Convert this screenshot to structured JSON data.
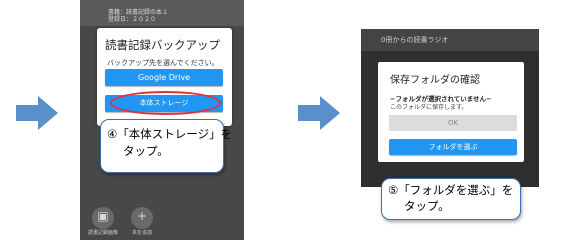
{
  "colors": {
    "arrow": "#5b8fc9",
    "button_blue": "#2196f3",
    "highlight_red": "#e0303a",
    "callout_border": "#3a6fb0"
  },
  "screen1": {
    "background_lines": [
      "書籍：読書記録の本１",
      "登録日：２０２０"
    ],
    "dialog": {
      "title": "読書記録バックアップ",
      "subtitle": "バックアップ先を選んでください。",
      "google_drive_label": "Google Drive",
      "main_storage_label": "本体ストレージ"
    },
    "fabs": [
      {
        "icon": "image-icon",
        "glyph": "▣",
        "label": "読書記録画像"
      },
      {
        "icon": "plus-icon",
        "glyph": "+",
        "label": "本を追加"
      }
    ],
    "callout": {
      "line1": "④「本体ストレージ」を",
      "line2": "タップ。"
    }
  },
  "screen2": {
    "background_text": "0冊からの読書ラジオ",
    "dialog": {
      "title": "保存フォルダの確認",
      "message": "−フォルダが選択されていません−",
      "message2": "このフォルダに保存します。",
      "ok_label": "OK",
      "select_folder_label": "フォルダを選ぶ"
    },
    "callout": {
      "line1": "⑤「フォルダを選ぶ」を",
      "line2": "タップ。"
    }
  }
}
